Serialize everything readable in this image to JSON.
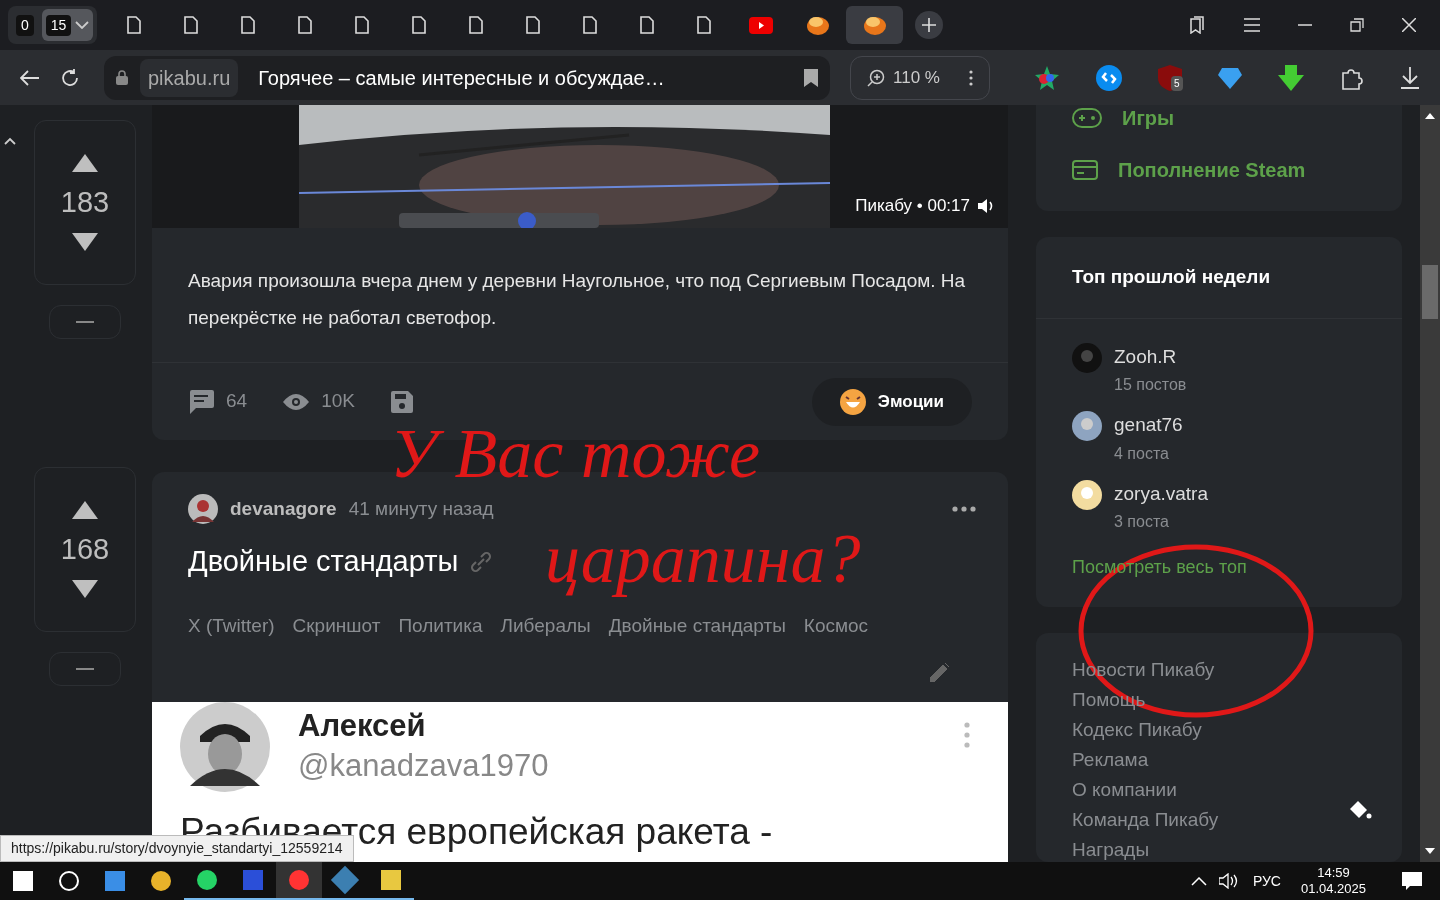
{
  "browser": {
    "counters": [
      {
        "label": "0",
        "selected": false
      },
      {
        "label": "15",
        "selected": true
      }
    ],
    "tabs": [
      {
        "kind": "page",
        "selected": false
      },
      {
        "kind": "page",
        "selected": false
      },
      {
        "kind": "page",
        "selected": false
      },
      {
        "kind": "page",
        "selected": false
      },
      {
        "kind": "page",
        "selected": false
      },
      {
        "kind": "page",
        "selected": false
      },
      {
        "kind": "page",
        "selected": false
      },
      {
        "kind": "page",
        "selected": false
      },
      {
        "kind": "page",
        "selected": false
      },
      {
        "kind": "page",
        "selected": false
      },
      {
        "kind": "page",
        "selected": false
      },
      {
        "kind": "video",
        "selected": false
      },
      {
        "kind": "site",
        "selected": false
      },
      {
        "kind": "site",
        "selected": true
      }
    ],
    "domain": "pikabu.ru",
    "page_title": "Горячее – самые интересные и обсуждае…",
    "zoom": "110 %",
    "extension_badge": "5"
  },
  "posts": [
    {
      "votes": "183",
      "video_label": "Пикабу • 00:17",
      "text": "Авария произошла вчера днем у деревни Наугольное, что под Сергиевым Посадом. На перекрёстке не работал светофор.",
      "comments": "64",
      "views": "10K",
      "emotions": "Эмоции"
    },
    {
      "votes": "168",
      "author": "devanagore",
      "time": "41 минуту назад",
      "title": "Двойные стандарты",
      "tags": [
        "X (Twitter)",
        "Скриншот",
        "Политика",
        "Либералы",
        "Двойные стандарты",
        "Космос"
      ],
      "tweet": {
        "name": "Алексей",
        "handle": "@kanadzava1970",
        "text": "Разбивается европейская ракета -"
      }
    }
  ],
  "sidebar": {
    "links": [
      "Игры",
      "Пополнение Steam"
    ],
    "top_title": "Топ прошлой недели",
    "users": [
      {
        "name": "Zooh.R",
        "posts": "15 постов"
      },
      {
        "name": "genat76",
        "posts": "4 поста"
      },
      {
        "name": "zorya.vatra",
        "posts": "3 поста"
      }
    ],
    "top_link": "Посмотреть весь топ",
    "footer_links": [
      "Новости Пикабу",
      "Помощь",
      "Кодекс Пикабу",
      "Реклама",
      "О компании",
      "Команда Пикабу",
      "Награды"
    ]
  },
  "status_url": "https://pikabu.ru/story/dvoynyie_standartyi_12559214",
  "annotation": [
    "У Вас тоже",
    "царапина?"
  ],
  "taskbar": {
    "language": "РУС",
    "time": "14:59",
    "date": "01.04.2025"
  }
}
